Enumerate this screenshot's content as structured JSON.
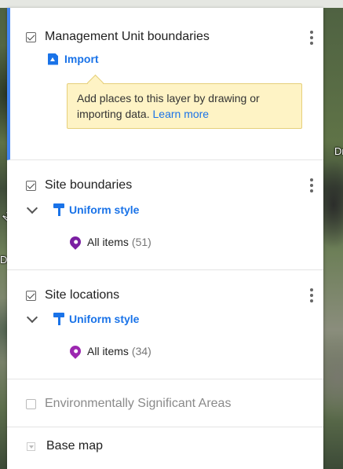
{
  "map": {
    "labels": [
      {
        "text": "Dr",
        "side": "left"
      },
      {
        "text": "M",
        "side": "left"
      },
      {
        "text": "Dr",
        "side": "right"
      }
    ]
  },
  "layers": [
    {
      "title": "Management Unit boundaries",
      "checked": true,
      "active": true,
      "action_label": "Import",
      "tooltip_text": "Add places to this layer by drawing or importing data.",
      "tooltip_link": "Learn more"
    },
    {
      "title": "Site boundaries",
      "checked": true,
      "style_label": "Uniform style",
      "items_label": "All items",
      "items_count": "(51)",
      "pin_color": "#7b1fa2"
    },
    {
      "title": "Site locations",
      "checked": true,
      "style_label": "Uniform style",
      "items_label": "All items",
      "items_count": "(34)",
      "pin_color": "#9c27b0"
    },
    {
      "title": "Environmentally Significant Areas",
      "checked": false
    }
  ],
  "basemap": {
    "label": "Base map"
  },
  "colors": {
    "accent": "#1a73e8",
    "active_border": "#4285f4",
    "tooltip_bg": "#fef3c5"
  }
}
